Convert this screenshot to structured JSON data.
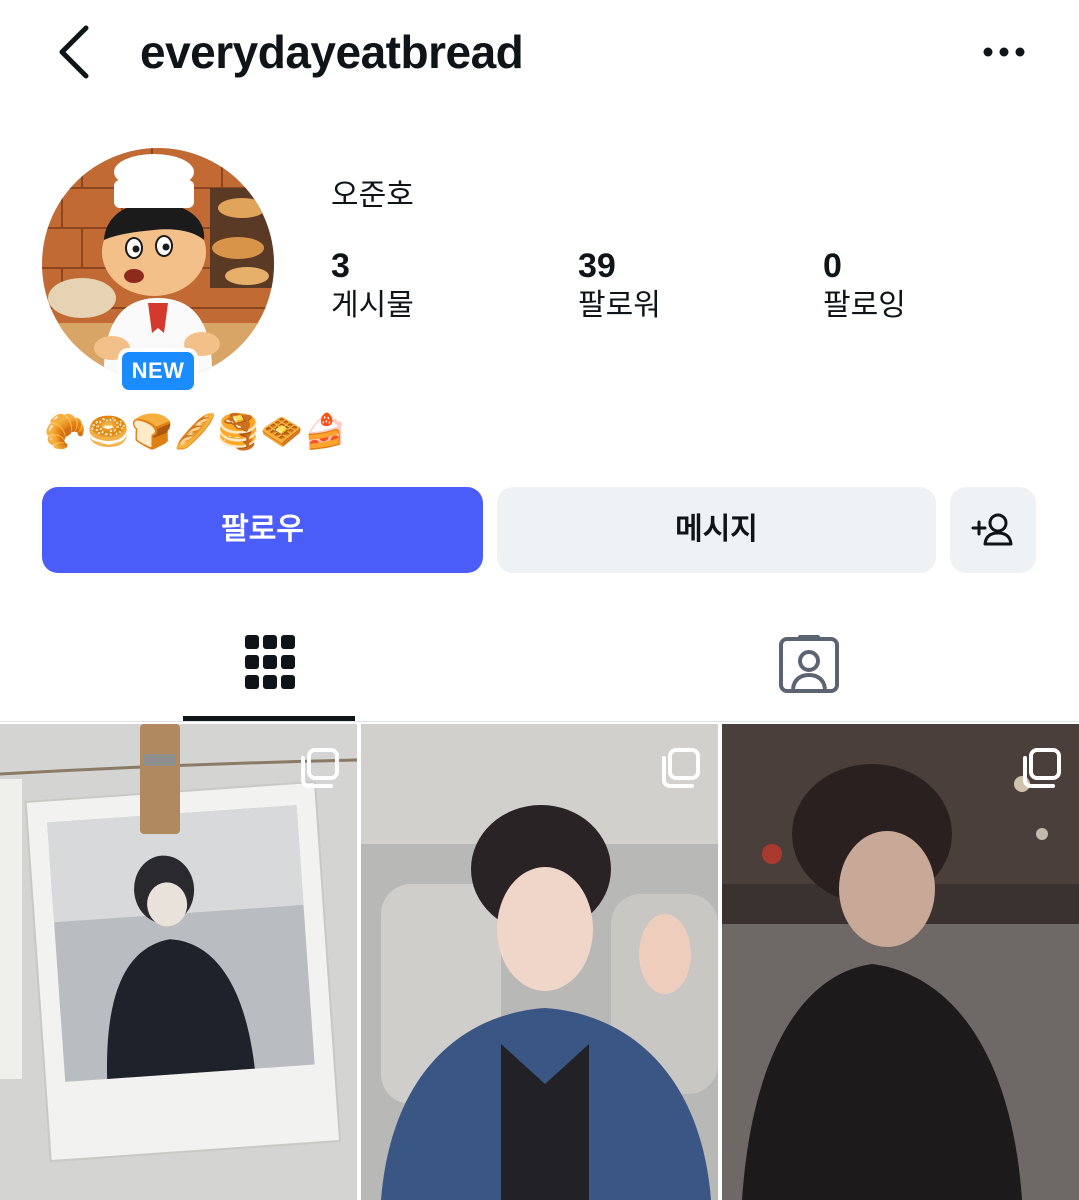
{
  "header": {
    "username": "everydayeatbread",
    "back_icon": "chevron-left-icon",
    "more_icon": "more-horizontal-icon"
  },
  "profile": {
    "display_name": "오준호",
    "badge": "NEW",
    "bio": "🥐🥯🍞🥖🥞🧇🍰",
    "stats": {
      "posts": {
        "value": "3",
        "label": "게시물"
      },
      "followers": {
        "value": "39",
        "label": "팔로워"
      },
      "following": {
        "value": "0",
        "label": "팔로잉"
      }
    }
  },
  "actions": {
    "follow_label": "팔로우",
    "message_label": "메시지",
    "add_user_icon": "add-user-icon"
  },
  "tabs": [
    {
      "name": "posts-grid",
      "icon": "grid-icon",
      "active": true
    },
    {
      "name": "tagged",
      "icon": "tagged-user-icon",
      "active": false
    }
  ],
  "posts": [
    {
      "multi": true,
      "icon": "multiple-photos-icon"
    },
    {
      "multi": true,
      "icon": "multiple-photos-icon"
    },
    {
      "multi": true,
      "icon": "multiple-photos-icon"
    }
  ],
  "colors": {
    "accent": "#4a5df9",
    "badge": "#1a8cff",
    "secondary_button": "#eff2f4",
    "text": "#0f1419"
  }
}
